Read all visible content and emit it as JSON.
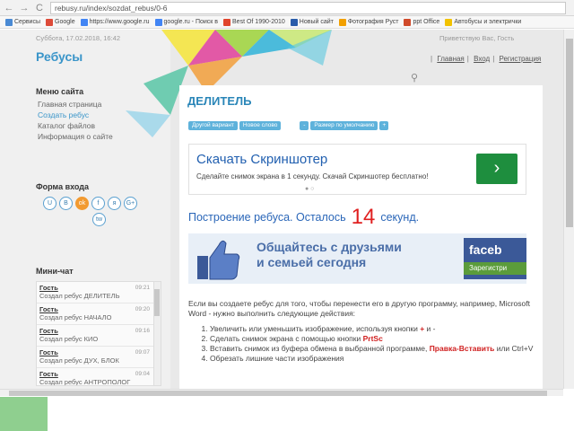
{
  "browser": {
    "nav": {
      "back": "←",
      "forward": "→",
      "reload": "C"
    },
    "url": "rebusy.ru/index/sozdat_rebus/0-6",
    "bookmarks": [
      {
        "label": "Сервисы",
        "color": "#4a8ad4"
      },
      {
        "label": "Google",
        "color": "#dd4b39"
      },
      {
        "label": "https://www.google.ru",
        "color": "#4285f4"
      },
      {
        "label": "google.ru - Поиск в",
        "color": "#4285f4"
      },
      {
        "label": "Best Of 1990-2010",
        "color": "#e0442c"
      },
      {
        "label": "Новый сайт",
        "color": "#2a5caa"
      },
      {
        "label": "Фотография Руст",
        "color": "#f2a000"
      },
      {
        "label": "ppt Office",
        "color": "#d04a2a"
      },
      {
        "label": "Автобусы и электрички",
        "color": "#f2c200"
      }
    ]
  },
  "header": {
    "datetime": "Суббота, 17.02.2018, 16:42",
    "greeting": "Приветствую Вас, Гость",
    "site_title": "Ребусы",
    "topnav": [
      "Главная",
      "Вход",
      "Регистрация"
    ]
  },
  "sidebar": {
    "menu_heading": "Меню сайта",
    "menu_items": [
      {
        "label": "Главная страница",
        "active": false
      },
      {
        "label": "Создать ребус",
        "active": true
      },
      {
        "label": "Каталог файлов",
        "active": false
      },
      {
        "label": "Информация о сайте",
        "active": false
      }
    ],
    "login_heading": "Форма входа",
    "socials": [
      "U",
      "B",
      "ok",
      "f",
      "я",
      "G+",
      "tw"
    ],
    "shout_heading": "Мини-чат",
    "shouts": [
      {
        "user": "Гость",
        "time": "09:21",
        "msg": "Создал ребус ДЕЛИТЕЛЬ"
      },
      {
        "user": "Гость",
        "time": "09:20",
        "msg": "Создал ребус НАЧАЛО"
      },
      {
        "user": "Гость",
        "time": "09:16",
        "msg": "Создал ребус КИО"
      },
      {
        "user": "Гость",
        "time": "09:07",
        "msg": "Создал ребус ДУХ, БЛОК"
      },
      {
        "user": "Гость",
        "time": "09:04",
        "msg": "Создал ребус АНТРОПОЛОГ"
      }
    ]
  },
  "main": {
    "title": "ДЕЛИТЕЛЬ",
    "buttons": {
      "other": "Другой вариант",
      "new_word": "Новое слово",
      "minus": "-",
      "size": "Размер по умолчанию",
      "plus": "+"
    },
    "ad": {
      "title": "Скачать Скриншотер",
      "desc": "Сделайте снимок экрана в 1 секунду. Скачай Скриншотер бесплатно!",
      "arrow": "›",
      "dots": "● ○"
    },
    "countdown": {
      "prefix": "Построение ребуса. Осталось",
      "value": "14",
      "suffix": "секунд."
    },
    "fb_ad": {
      "line1": "Общайтесь с друзьями",
      "line2": "и семьей сегодня",
      "brand": "faceb",
      "register": "Зарегистри"
    },
    "intro": "Если вы создаете ребус для того, чтобы перенести его в другую программу, например, Microsoft Word - нужно выполнить следующие действия:",
    "steps": [
      {
        "text": "Увеличить или уменьшить изображение, используя кнопки ",
        "red": "+",
        "tail": " и -"
      },
      {
        "text": "Сделать снимок экрана с помощью кнопки ",
        "red": "PrtSc",
        "tail": ""
      },
      {
        "text": "Вставить снимок из буфера обмена в выбранной программе, ",
        "red": "Правка-Вставить",
        "tail": " или Ctrl+V"
      },
      {
        "text": "Обрезать лишние части изображения",
        "red": "",
        "tail": ""
      }
    ]
  }
}
